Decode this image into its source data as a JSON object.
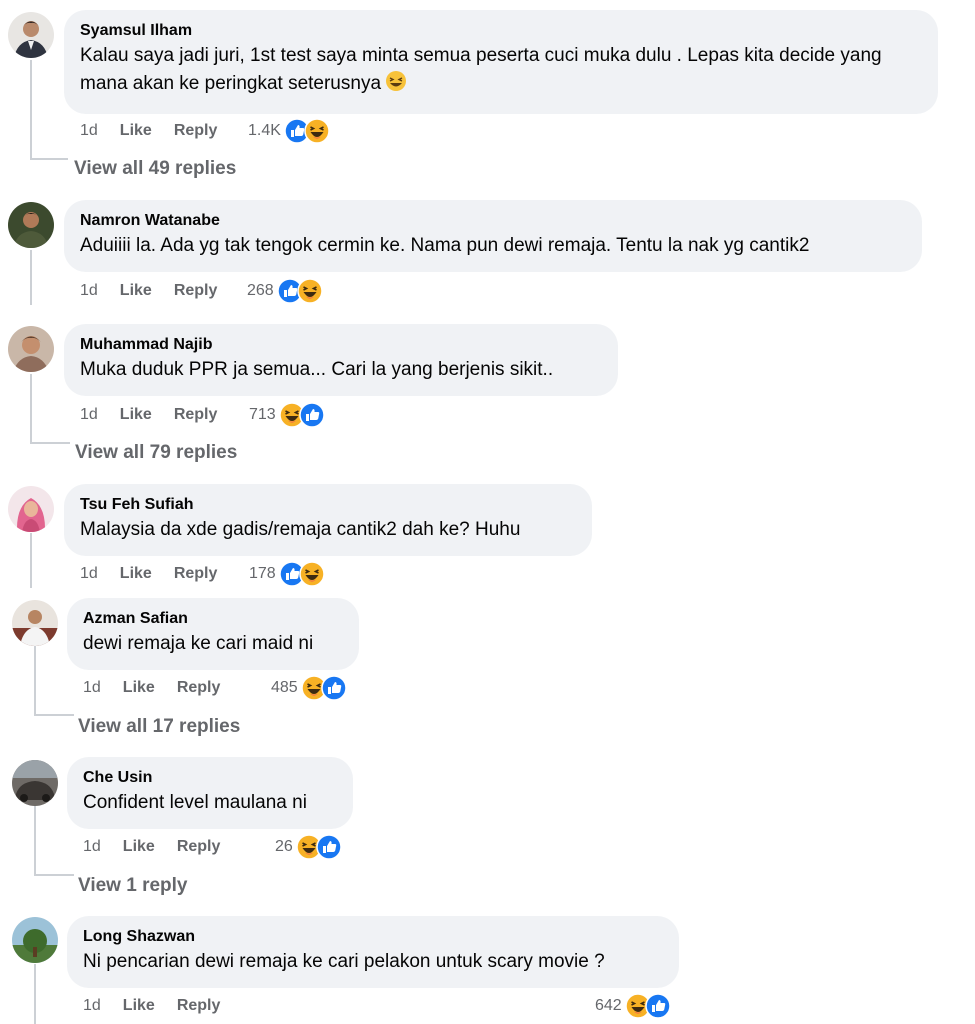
{
  "labels": {
    "like": "Like",
    "reply": "Reply"
  },
  "colors": {
    "bubble": "#f0f2f5",
    "meta": "#65676b",
    "like_blue": "#1877f2",
    "haha_yellow": "#f7b125"
  },
  "comments": [
    {
      "author": "Syamsul Ilham",
      "text": "Kalau saya jadi juri, 1st test saya minta semua peserta cuci muka dulu . Lepas kita decide yang mana akan ke peringkat seterusnya",
      "trailing_emoji": "laughing-emoji",
      "time": "1d",
      "reaction_count": "1.4K",
      "reactions": [
        "like",
        "haha"
      ],
      "view_replies": "View all 49 replies"
    },
    {
      "author": "Namron Watanabe",
      "text": "Aduiiii la. Ada yg tak tengok cermin ke. Nama pun dewi remaja. Tentu la nak yg cantik2",
      "time": "1d",
      "reaction_count": "268",
      "reactions": [
        "like",
        "haha"
      ],
      "view_replies": ""
    },
    {
      "author": "Muhammad Najib",
      "text": "Muka duduk PPR ja semua... Cari la yang berjenis sikit..",
      "time": "1d",
      "reaction_count": "713",
      "reactions": [
        "haha",
        "like"
      ],
      "view_replies": "View all 79 replies"
    },
    {
      "author": "Tsu Feh Sufiah",
      "text": "Malaysia da xde gadis/remaja cantik2 dah ke? Huhu",
      "time": "1d",
      "reaction_count": "178",
      "reactions": [
        "like",
        "haha"
      ],
      "view_replies": ""
    },
    {
      "author": "Azman Safian",
      "text": "dewi remaja ke cari maid ni",
      "time": "1d",
      "reaction_count": "485",
      "reactions": [
        "haha",
        "like"
      ],
      "view_replies": "View all 17 replies"
    },
    {
      "author": "Che Usin",
      "text": "Confident level maulana ni",
      "time": "1d",
      "reaction_count": "26",
      "reactions": [
        "haha",
        "like"
      ],
      "view_replies": "View 1 reply"
    },
    {
      "author": "Long Shazwan",
      "text": "Ni pencarian dewi remaja ke cari pelakon untuk scary movie ?",
      "time": "1d",
      "reaction_count": "642",
      "reactions": [
        "haha",
        "like"
      ],
      "view_replies": ""
    }
  ]
}
